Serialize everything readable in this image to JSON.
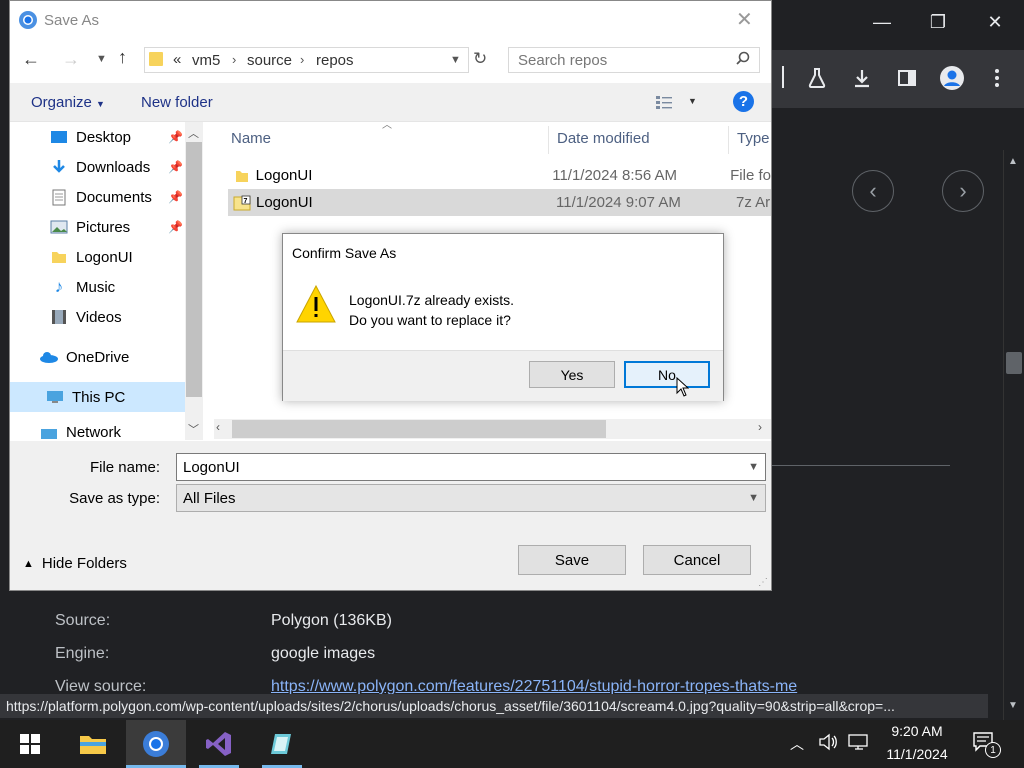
{
  "browser": {
    "window_controls": {
      "minimize": "—",
      "maximize": "❐",
      "close": "✕"
    },
    "toolbar_icons": [
      "flask-icon",
      "download-icon",
      "sidebar-icon",
      "profile-icon",
      "menu-icon"
    ],
    "nav_buttons": {
      "prev": "‹",
      "next": "›"
    },
    "metadata": {
      "source_label": "Source:",
      "source_value": "Polygon (136KB)",
      "engine_label": "Engine:",
      "engine_value": "google images",
      "view_source_label": "View source:",
      "view_source_link": "https://www.polygon.com/features/22751104/stupid-horror-tropes-thats-me"
    },
    "status_url": "https://platform.polygon.com/wp-content/uploads/sites/2/chorus/uploads/chorus_asset/file/3601104/scream4.0.jpg?quality=90&strip=all&crop=..."
  },
  "save_dialog": {
    "title": "Save As",
    "breadcrumb": {
      "overflow": "«",
      "parts": [
        "vm5",
        "source",
        "repos"
      ]
    },
    "search_placeholder": "Search repos",
    "organize_label": "Organize",
    "new_folder_label": "New folder",
    "nav_items": [
      {
        "label": "Desktop",
        "icon": "desktop-icon",
        "pinned": true
      },
      {
        "label": "Downloads",
        "icon": "downloads-icon",
        "pinned": true
      },
      {
        "label": "Documents",
        "icon": "documents-icon",
        "pinned": true
      },
      {
        "label": "Pictures",
        "icon": "pictures-icon",
        "pinned": true
      },
      {
        "label": "LogonUI",
        "icon": "folder-icon",
        "pinned": false
      },
      {
        "label": "Music",
        "icon": "music-icon",
        "pinned": false
      },
      {
        "label": "Videos",
        "icon": "videos-icon",
        "pinned": false
      },
      {
        "label": "OneDrive",
        "icon": "onedrive-icon",
        "pinned": false
      },
      {
        "label": "This PC",
        "icon": "this-pc-icon",
        "pinned": false
      },
      {
        "label": "Network",
        "icon": "network-icon",
        "pinned": false
      }
    ],
    "columns": {
      "name": "Name",
      "date_modified": "Date modified",
      "type": "Type"
    },
    "files": [
      {
        "name": "LogonUI",
        "date": "11/1/2024 8:56 AM",
        "type": "File fo",
        "icon": "folder-icon"
      },
      {
        "name": "LogonUI",
        "date": "11/1/2024 9:07 AM",
        "type": "7z Ar",
        "icon": "7z-archive-icon"
      }
    ],
    "file_name_label": "File name:",
    "file_name_value": "LogonUI",
    "save_type_label": "Save as type:",
    "save_type_value": "All Files",
    "hide_folders_label": "Hide Folders",
    "save_label": "Save",
    "cancel_label": "Cancel"
  },
  "confirm_dialog": {
    "title": "Confirm Save As",
    "message_line1": "LogonUI.7z already exists.",
    "message_line2": "Do you want to replace it?",
    "yes_label": "Yes",
    "no_label": "No"
  },
  "taskbar": {
    "time": "9:20 AM",
    "date": "11/1/2024",
    "notification_count": "1"
  },
  "colors": {
    "browser_bg": "#202124",
    "link": "#8ab4f8",
    "selection": "#cce8ff",
    "help_blue": "#1a73e8",
    "warning_yellow": "#ffd400"
  }
}
